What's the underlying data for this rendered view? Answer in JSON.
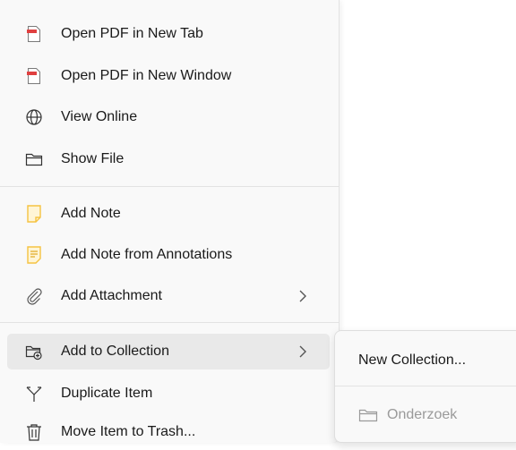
{
  "menu": {
    "items": [
      {
        "label": "Open PDF in New Tab",
        "icon": "pdf-icon"
      },
      {
        "label": "Open PDF in New Window",
        "icon": "pdf-icon"
      },
      {
        "label": "View Online",
        "icon": "globe-icon"
      },
      {
        "label": "Show File",
        "icon": "folder-icon"
      },
      {
        "label": "Add Note",
        "icon": "note-icon"
      },
      {
        "label": "Add Note from Annotations",
        "icon": "note-annotations-icon"
      },
      {
        "label": "Add Attachment",
        "icon": "paperclip-icon"
      },
      {
        "label": "Add to Collection",
        "icon": "collection-add-icon"
      },
      {
        "label": "Duplicate Item",
        "icon": "duplicate-icon"
      },
      {
        "label": "Move Item to Trash...",
        "icon": "trash-icon"
      }
    ]
  },
  "submenu": {
    "new_collection": "New Collection...",
    "collections": [
      {
        "label": "Onderzoek",
        "icon": "folder-icon"
      }
    ]
  },
  "colors": {
    "pdf_red": "#e04040",
    "note_yellow": "#f5c342",
    "hover_bg": "#e9e9e9",
    "disabled_text": "#9a9a9a"
  }
}
